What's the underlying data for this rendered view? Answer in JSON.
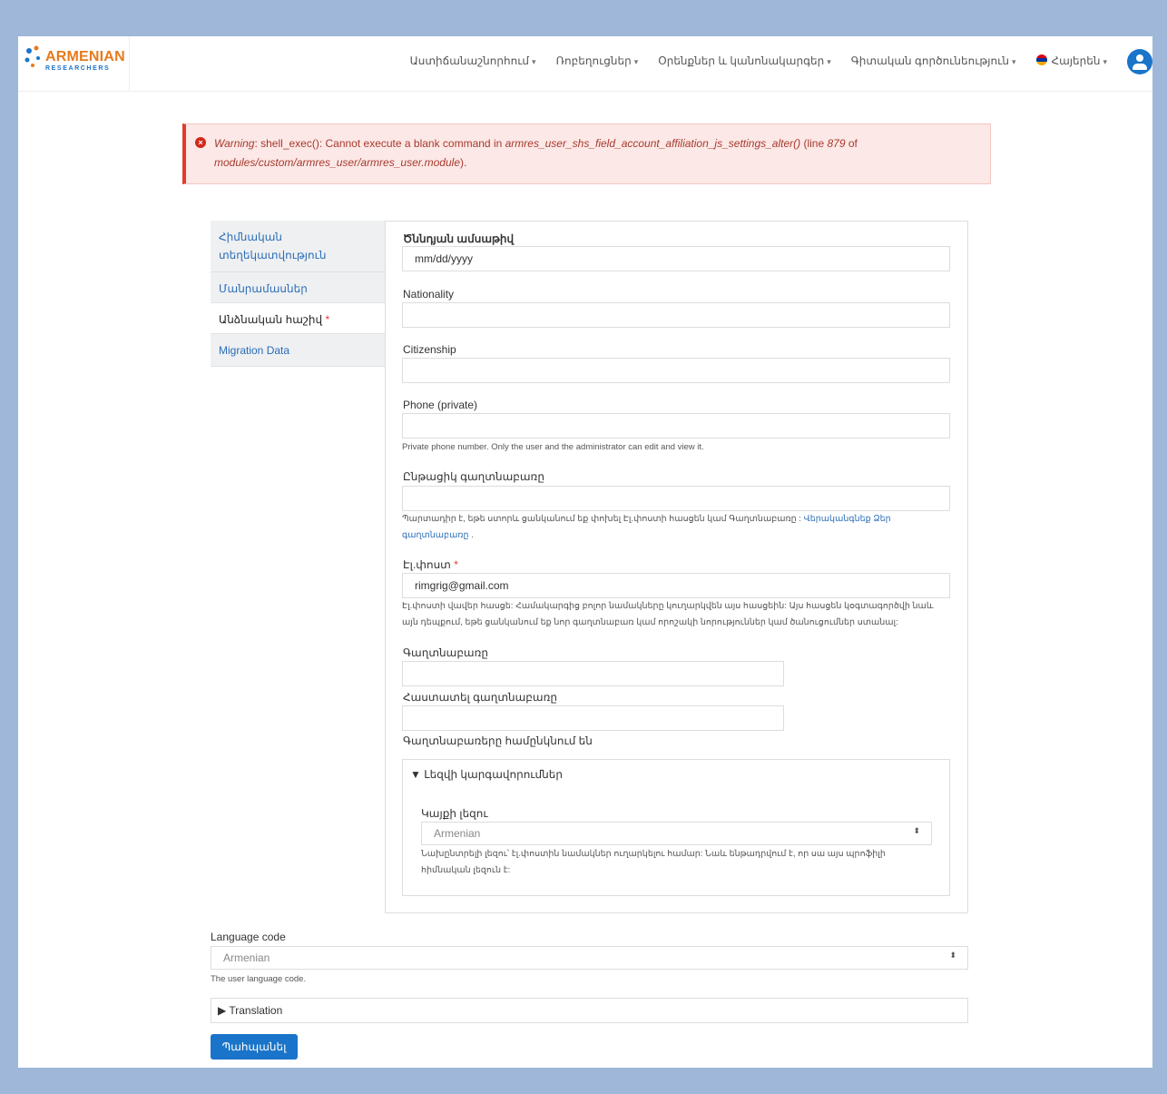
{
  "header": {
    "logo_text": "ARMENIAN",
    "logo_sub": "RESEARCHERS",
    "nav": [
      {
        "label": "Աստիճանաշնորհում"
      },
      {
        "label": "Ռոբեղուցներ"
      },
      {
        "label": "Օրենքներ և կանոնակարգեր"
      },
      {
        "label": "Գիտական գործունեություն"
      }
    ],
    "language": "Հայերեն"
  },
  "warning": {
    "prefix": "Warning",
    "message": ": shell_exec(): Cannot execute a blank command in ",
    "function": "armres_user_shs_field_account_affiliation_js_settings_alter()",
    "line_text": " (line ",
    "line": "879",
    "of_text": " of",
    "file": "modules/custom/armres_user/armres_user.module",
    "end": ")."
  },
  "tabs": [
    {
      "label": "Հիմնական տեղեկատվություն"
    },
    {
      "label": "Մանրամասներ"
    },
    {
      "label": "Անձնական հաշիվ",
      "required": "*"
    },
    {
      "label": "Migration Data"
    }
  ],
  "form": {
    "birthdate": {
      "label": "Ծննդյան ամսաթիվ",
      "value": "mm/dd/yyyy"
    },
    "nationality": {
      "label": "Nationality",
      "value": ""
    },
    "citizenship": {
      "label": "Citizenship",
      "value": ""
    },
    "phone": {
      "label": "Phone (private)",
      "value": "",
      "description": "Private phone number. Only the user and the administrator can edit and view it."
    },
    "current_password": {
      "label": "Ընթացիկ գաղտնաբառը",
      "description": "Պարտադիր է, եթե ստորև ցանկանում եք փոխել Էլ.փոստի հասցեն կամ Գաղտնաբառը",
      "link": "Վերականգնեք Ձեր գաղտնաբառը"
    },
    "email": {
      "label": "Էլ.փոստ",
      "required": "*",
      "value": "rimgrig@gmail.com",
      "description": "Էլ.փոստի վավեր հասցե: Համակարգից բոլոր նամակները կուղարկվեն այս հասցեին: Այս հասցեն կօգտագործվի նաև այն դեպքում, եթե ցանկանում եք նոր գաղտնաբառ կամ որոշակի նորություններ կամ ծանուցումներ ստանալ:"
    },
    "password": {
      "label": "Գաղտնաբառը"
    },
    "confirm_password": {
      "label": "Հաստատել գաղտնաբառը"
    },
    "password_match": "Գաղտնաբառերը համընկնում են",
    "language_settings": {
      "summary": "Լեզվի կարգավորումներ",
      "site_language_label": "Կայքի լեզու",
      "site_language_value": "Armenian",
      "description": "Նախընտրելի լեզու՝ էլ.փոստին նամակներ ուղարկելու համար: Նաև ենթադրվում է, որ սա այս պրոֆիլի հիմնական լեզուն է:"
    }
  },
  "language_code": {
    "label": "Language code",
    "value": "Armenian",
    "description": "The user language code."
  },
  "translation": {
    "summary": "Translation"
  },
  "save_label": "Պահպանել"
}
